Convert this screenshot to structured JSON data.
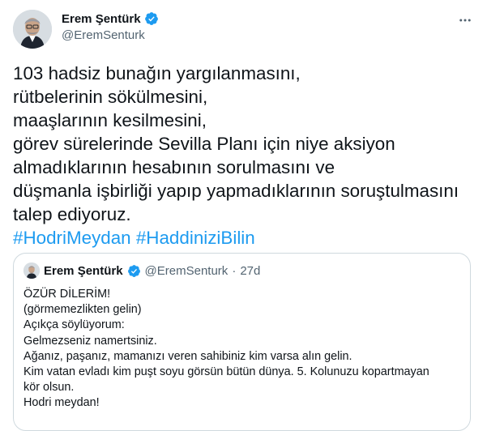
{
  "tweet": {
    "author": {
      "name": "Erem Şentürk",
      "handle": "@EremSenturk",
      "verified": true
    },
    "text_lines": [
      "103 hadsiz bunağın yargılanmasını,",
      "rütbelerinin sökülmesini,",
      "maaşlarının kesilmesini,",
      "görev sürelerinde Sevilla Planı için niye aksiyon",
      "almadıklarının hesabının sorulmasını ve",
      "düşmanla işbirliği yapıp yapmadıklarının soruştulmasını",
      "talep ediyoruz."
    ],
    "hashtags": [
      "#HodriMeydan",
      "#HaddiniziBilin"
    ]
  },
  "quote": {
    "author": {
      "name": "Erem Şentürk",
      "handle": "@EremSenturk",
      "verified": true
    },
    "separator": "·",
    "time": "27d",
    "text_lines": [
      "ÖZÜR DİLERİM!",
      "(görmemezlikten gelin)",
      "Açıkça söylüyorum:",
      "Gelmezseniz namertsiniz.",
      "Ağanız, paşanız, mamanızı veren sahibiniz kim varsa alın gelin.",
      "Kim vatan evladı kim puşt soyu görsün bütün dünya. 5. Kolunuzu kopartmayan",
      "kör olsun.",
      "Hodri meydan!"
    ]
  },
  "colors": {
    "accent": "#1d9bf0",
    "text": "#0f1419",
    "secondary": "#536471",
    "border": "#cfd9de"
  },
  "icons": {
    "verified": "verified-badge-icon",
    "more": "more-options-icon"
  }
}
